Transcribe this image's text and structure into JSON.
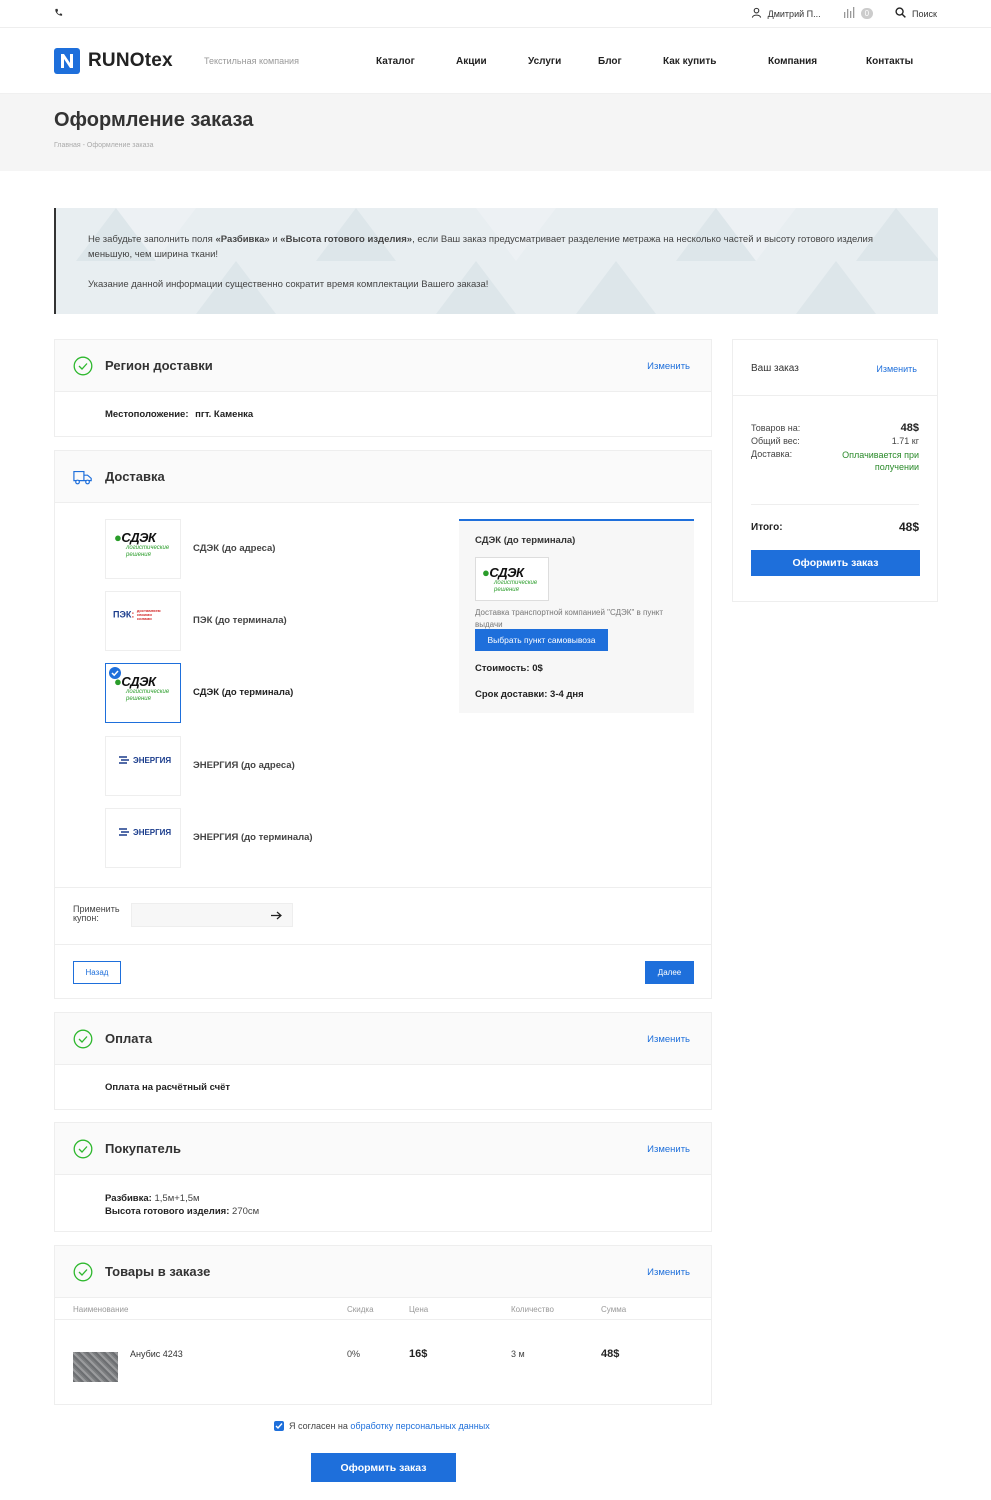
{
  "topbar": {
    "phone_icon": "phone-icon",
    "user_name": "Дмитрий П...",
    "compare_count": "0",
    "search_label": "Поиск"
  },
  "header": {
    "logo_text": "RUNOtex",
    "tagline": "Текстильная компания",
    "nav": [
      "Каталог",
      "Акции",
      "Услуги",
      "Блог",
      "Как купить",
      "Компания",
      "Контакты"
    ]
  },
  "page": {
    "title": "Оформление заказа",
    "breadcrumb": [
      "Главная",
      "Оформление заказа"
    ]
  },
  "notice": {
    "line1_pre": "Не забудьте заполнить поля ",
    "line1_b1": "«Разбивка»",
    "line1_mid": " и ",
    "line1_b2": "«Высота готового изделия»",
    "line1_post": ", если Ваш заказ предусматривает разделение метража на несколько частей и высоту готового изделия меньшую, чем ширина ткани!",
    "line2": "Указание данной информации существенно сократит время комплектации Вашего заказа!"
  },
  "region": {
    "title": "Регион доставки",
    "change": "Изменить",
    "location_label": "Местоположение:",
    "location_value": "пгт. Каменка"
  },
  "delivery": {
    "title": "Доставка",
    "options": [
      {
        "label": "СДЭК (до адреса)",
        "logo": "СДЭК"
      },
      {
        "label": "ПЭК (до терминала)",
        "logo": "ПЭК"
      },
      {
        "label": "СДЭК (до терминала)",
        "logo": "СДЭК"
      },
      {
        "label": "ЭНЕРГИЯ (до адреса)",
        "logo": "ЭНЕРГИЯ"
      },
      {
        "label": "ЭНЕРГИЯ (до терминала)",
        "logo": "ЭНЕРГИЯ"
      }
    ],
    "logo_cdek": "СДЭК",
    "logo_cdek_sub1": "логистические",
    "logo_cdek_sub2": "решения",
    "logo_pek": "ПЭК",
    "logo_pek_sub": "доставляем своими силами",
    "logo_energy": "ЭНЕРГИЯ",
    "selected": {
      "title": "СДЭК (до терминала)",
      "description": "Доставка транспортной компанией \"СДЭК\" в пункт выдачи",
      "pickup_button": "Выбрать пункт самовывоза",
      "cost_label": "Стоимость:",
      "cost_value": "0$",
      "term_label": "Срок доставки:",
      "term_value": "3-4 дня"
    },
    "coupon_label": "Применить купон:",
    "coupon_placeholder": "",
    "back_button": "Назад",
    "next_button": "Далее"
  },
  "payment": {
    "title": "Оплата",
    "change": "Изменить",
    "value": "Оплата на расчётный счёт"
  },
  "buyer": {
    "title": "Покупатель",
    "change": "Изменить",
    "split_label": "Разбивка:",
    "split_value": "1,5м+1,5м",
    "height_label": "Высота готового изделия:",
    "height_value": "270см"
  },
  "goods": {
    "title": "Товары в заказе",
    "change": "Изменить",
    "columns": [
      "Наименование",
      "Скидка",
      "Цена",
      "Количество",
      "Сумма"
    ],
    "rows": [
      {
        "name": "Анубис 4243",
        "discount": "0%",
        "price": "16$",
        "qty": "3 м",
        "sum": "48$"
      }
    ]
  },
  "consent": {
    "checked": true,
    "pre": "Я согласен на ",
    "link": "обработку персональных данных"
  },
  "submit_button": "Оформить заказ",
  "summary": {
    "title": "Ваш заказ",
    "change": "Изменить",
    "goods_label": "Товаров на:",
    "goods_value": "48$",
    "weight_label": "Общий вес:",
    "weight_value": "1.71 кг",
    "delivery_label": "Доставка:",
    "delivery_value": "Оплачивается при получении",
    "total_label": "Итого:",
    "total_value": "48$",
    "button": "Оформить заказ"
  },
  "colors": {
    "accent": "#1e6fdb",
    "check": "#2eb82e",
    "delivery_note": "#2a8a2a"
  }
}
